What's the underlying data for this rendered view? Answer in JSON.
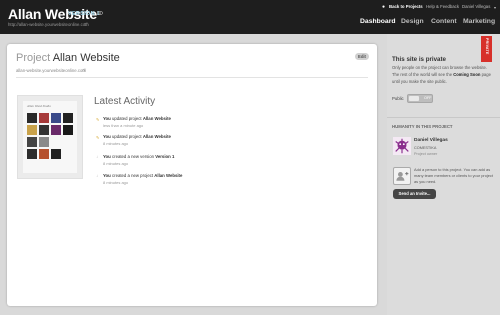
{
  "header": {
    "site_title": "Allan Website",
    "version": "VERSION 1",
    "site_url": "http://allan-website.yourwebsiteonline.com",
    "back_link": "Back to Projects",
    "help_link": "Help & Feedback",
    "user_name": "Daniel Villegas",
    "nav": [
      "Dashboard",
      "Design",
      "Content",
      "Marketing"
    ]
  },
  "project": {
    "label": "Project",
    "name": "Allan Website",
    "url": "allan-website.yourwebsiteonline.com",
    "edit_label": "Edit",
    "thumbnail_title": "Allan Wood Studio"
  },
  "activity": {
    "heading": "Latest Activity",
    "items": [
      {
        "prefix": "You",
        "verb": " updated project ",
        "target": "Allan Website",
        "time": "less than a minute ago",
        "icon": "pencil-icon"
      },
      {
        "prefix": "You",
        "verb": " updated project ",
        "target": "Allan Website",
        "time": "8 minutes ago",
        "icon": "pencil-icon"
      },
      {
        "prefix": "You",
        "verb": " created a new version ",
        "target": "Version 1",
        "time": "8 minutes ago",
        "icon": "arrow-icon"
      },
      {
        "prefix": "You",
        "verb": " created a new project ",
        "target": "Allan Website",
        "time": "8 minutes ago",
        "icon": "arrow-icon"
      }
    ]
  },
  "sidebar": {
    "ribbon": "PRIVATE",
    "private_title": "This site is private",
    "private_desc_1": "Only people on the project can browse the website. The rest of the world will see the ",
    "private_desc_bold": "Coming Soon",
    "private_desc_2": " page until you make the site public.",
    "public_label": "Public",
    "toggle_text": "OFF",
    "humanity_title": "HUMANITY IN THIS PROJECT",
    "member": {
      "name": "Daniel Villegas",
      "org": "COMESTIKA",
      "role": "Project owner"
    },
    "invite_text": "Add a person to this project. You can add as many team members or clients to your project as you need.",
    "send_invite": "Send an Invite..."
  },
  "colors": {
    "topbar": "#1e1e1e",
    "version_accent": "#9fd6ea",
    "ribbon_red": "#d7302a",
    "avatar_purple": "#8a2e8d"
  }
}
